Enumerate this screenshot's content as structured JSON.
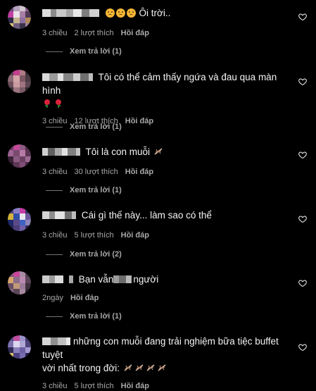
{
  "colors": {
    "background": "#000000",
    "text_primary": "#f5f5f5",
    "text_secondary": "#a8a8a8",
    "divider": "#737373"
  },
  "comments": [
    {
      "body_text": "Ôi trời..",
      "emoji_before": "worried-face ×3",
      "meta": {
        "time": "3 chiều",
        "likes": "2 lượt thích",
        "reply": "Hồi đáp"
      },
      "view_replies": "Xem trả lời (1)",
      "icon": "heart-icon"
    },
    {
      "body_text": "Tôi có thể cảm thấy ngứa và đau qua màn hình",
      "emoji_after": "rose ×2",
      "meta": {
        "time": "3 chiều",
        "likes": "12 lượt thích",
        "reply": "Hồi đáp"
      },
      "view_replies": "Xem trả lời (1)",
      "icon": "heart-icon"
    },
    {
      "body_text": "Tôi là con muỗi",
      "emoji_after": "mosquito ×1",
      "meta": {
        "time": "3 chiều",
        "likes": "30 lượt thích",
        "reply": "Hồi đáp"
      },
      "view_replies": "Xem trả lời (1)",
      "icon": "heart-icon"
    },
    {
      "body_text": "Cái gì thế này... làm sao có thể",
      "meta": {
        "time": "3 chiều",
        "likes": "5 lượt thích",
        "reply": "Hồi đáp"
      },
      "view_replies": "Xem trả lời (2)",
      "icon": "heart-icon"
    },
    {
      "body_text_a": "Bạn vẫn",
      "body_text_b": "người",
      "meta": {
        "time": "2ngày",
        "reply": "Hồi đáp"
      },
      "view_replies": "Xem trả lời (1)",
      "icon": "heart-icon"
    },
    {
      "body_text_line1": "những con muỗi đang trải nghiệm bữa tiệc buffet tuyệt",
      "body_text_line2": "vời nhất trong đời:",
      "emoji_after": "mosquito ×4",
      "meta": {
        "time": "3 chiều",
        "likes": "5 lượt thích",
        "reply": "Hồi đáp"
      },
      "icon": "heart-icon"
    }
  ]
}
